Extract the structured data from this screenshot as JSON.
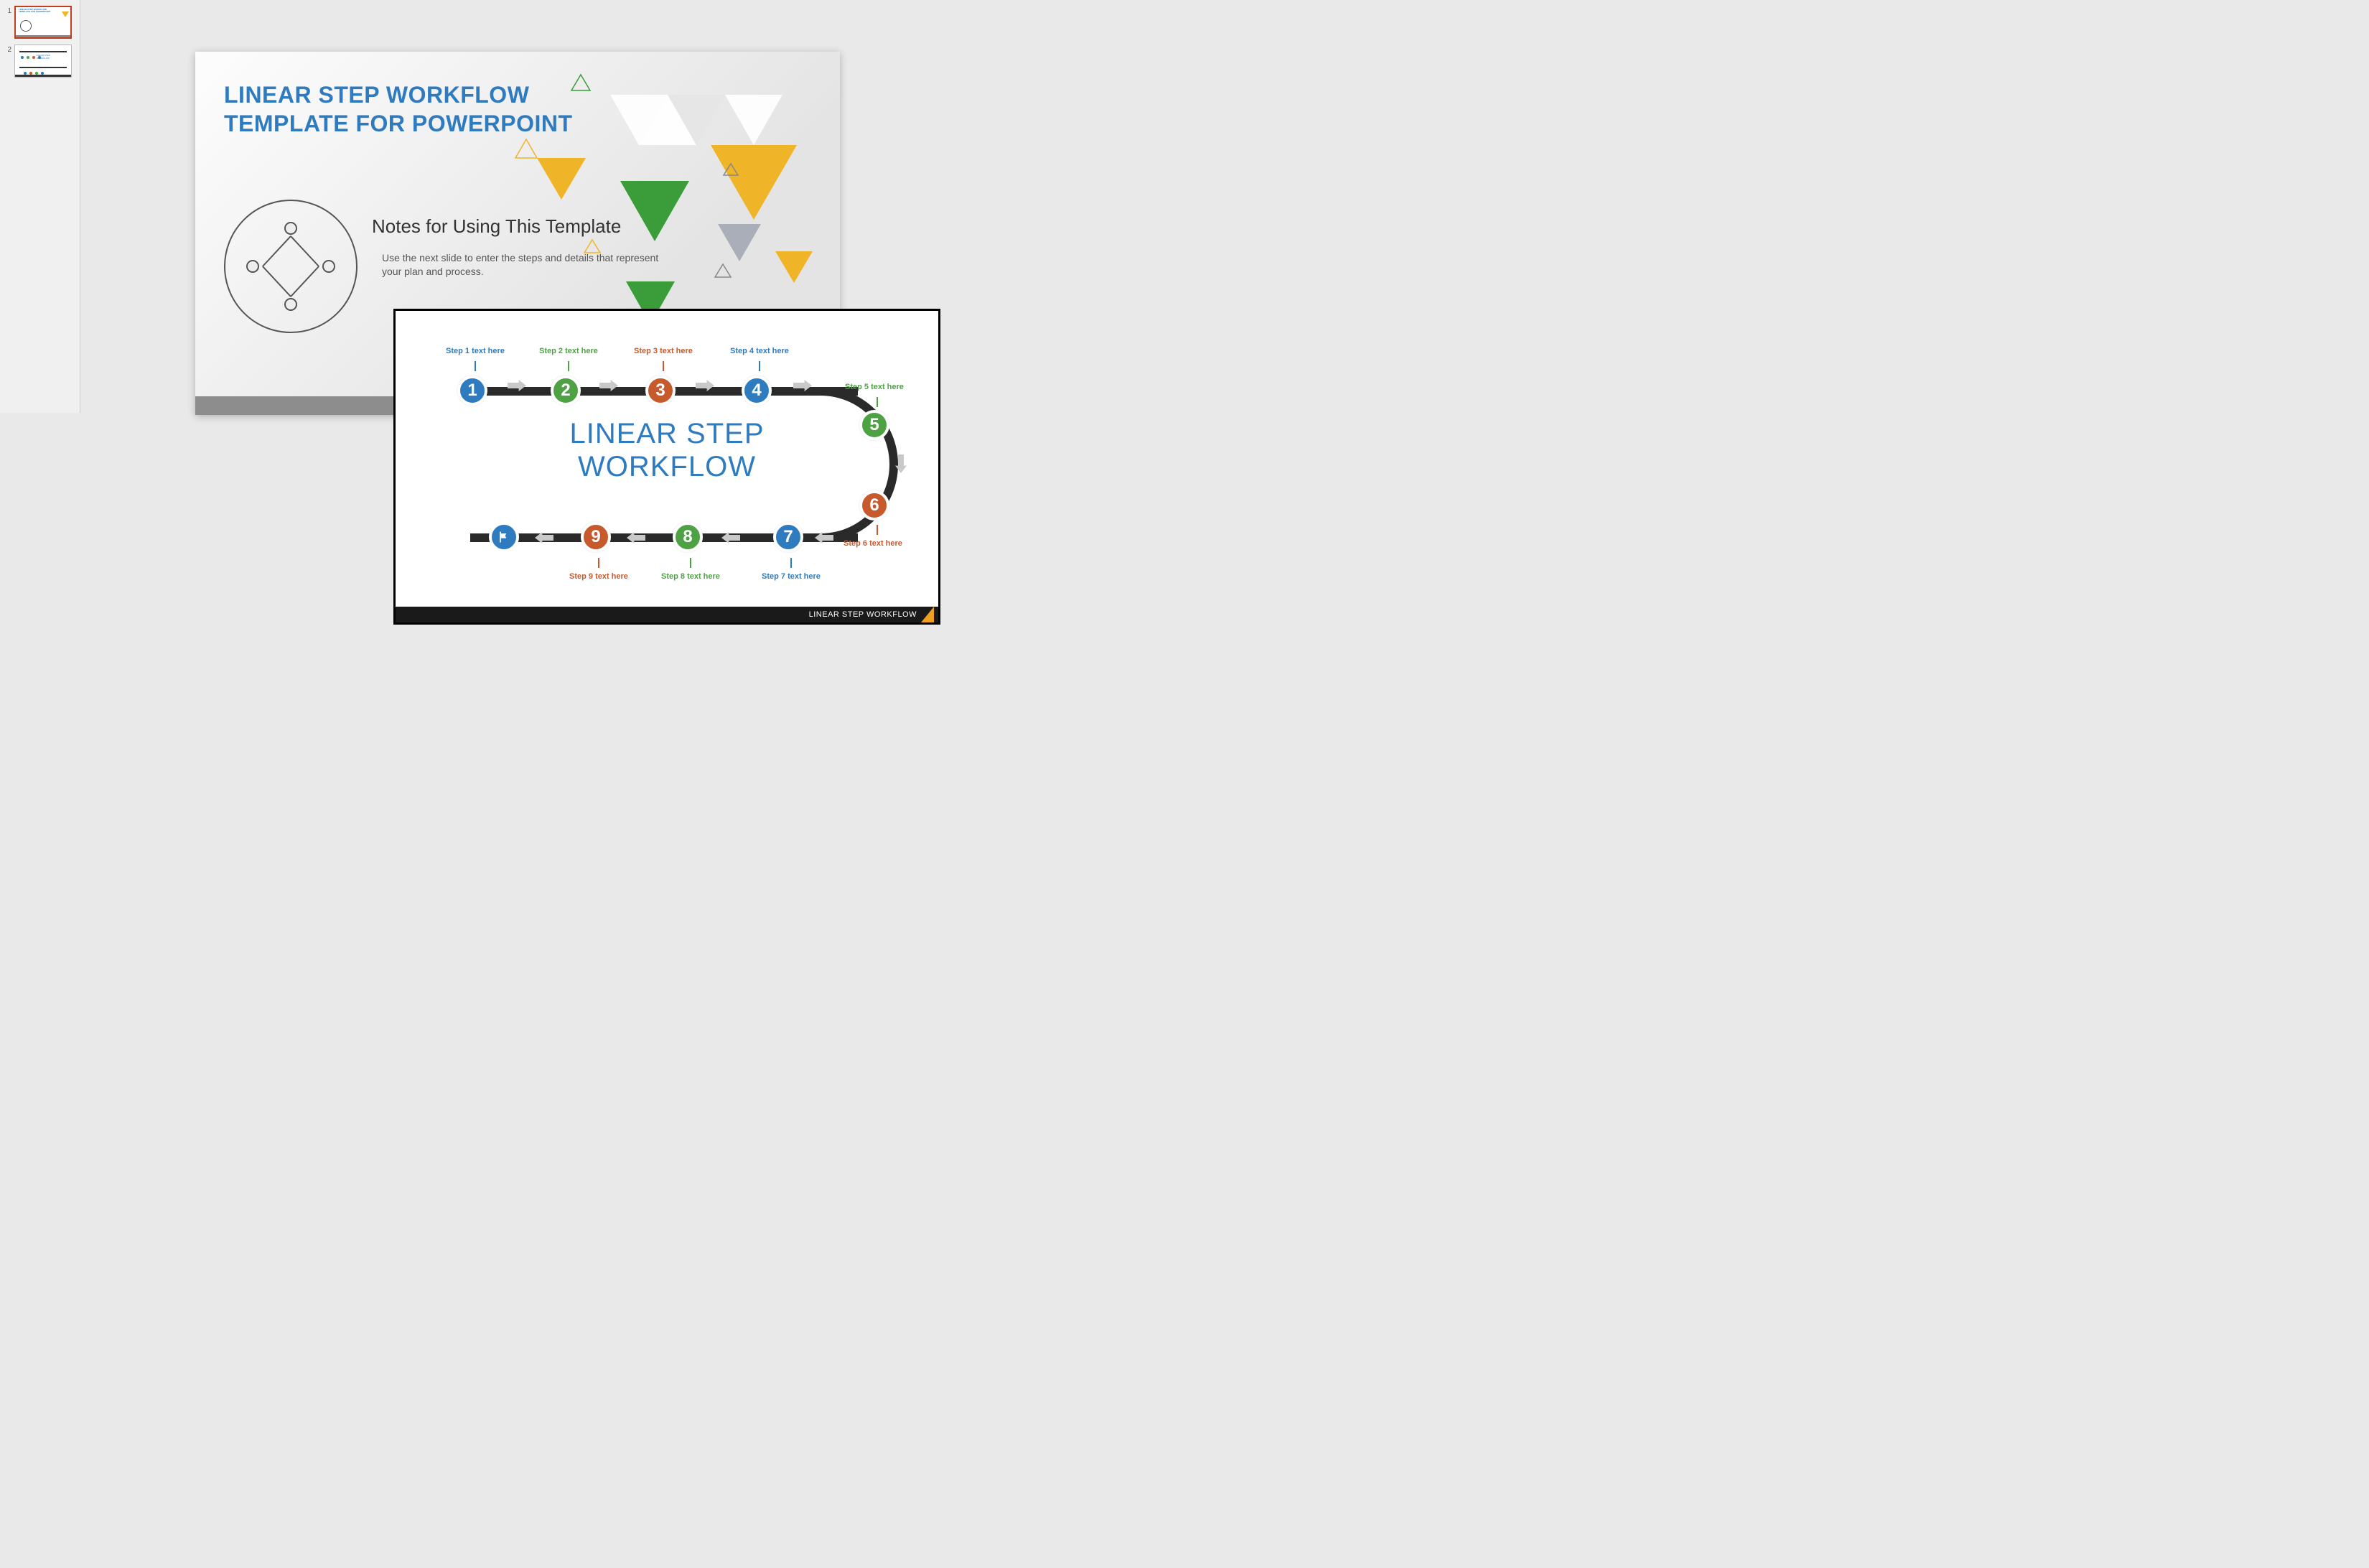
{
  "thumbnails": [
    {
      "num": "1",
      "active": true
    },
    {
      "num": "2",
      "active": false
    }
  ],
  "slide1": {
    "title_line1": "LINEAR STEP WORKFLOW",
    "title_line2": "TEMPLATE FOR POWERPOINT",
    "subtitle": "Notes for Using This Template",
    "body": "Use the next slide to enter the steps and details that represent your plan and process."
  },
  "slide2": {
    "title_line1": "LINEAR STEP",
    "title_line2": "WORKFLOW",
    "footer": "LINEAR STEP WORKFLOW",
    "steps": [
      {
        "n": "1",
        "label": "Step 1 text here",
        "color": "c-blue",
        "lblColor": "#2e7bbf"
      },
      {
        "n": "2",
        "label": "Step 2 text here",
        "color": "c-green",
        "lblColor": "#4fa244"
      },
      {
        "n": "3",
        "label": "Step 3 text here",
        "color": "c-orange",
        "lblColor": "#c65a2d"
      },
      {
        "n": "4",
        "label": "Step 4 text here",
        "color": "c-blue",
        "lblColor": "#2e7bbf"
      },
      {
        "n": "5",
        "label": "Step 5 text here",
        "color": "c-green",
        "lblColor": "#4fa244"
      },
      {
        "n": "6",
        "label": "Step 6 text here",
        "color": "c-orange",
        "lblColor": "#c65a2d"
      },
      {
        "n": "7",
        "label": "Step 7 text here",
        "color": "c-blue",
        "lblColor": "#2e7bbf"
      },
      {
        "n": "8",
        "label": "Step 8 text here",
        "color": "c-green",
        "lblColor": "#4fa244"
      },
      {
        "n": "9",
        "label": "Step 9 text here",
        "color": "c-orange",
        "lblColor": "#c65a2d"
      }
    ]
  }
}
